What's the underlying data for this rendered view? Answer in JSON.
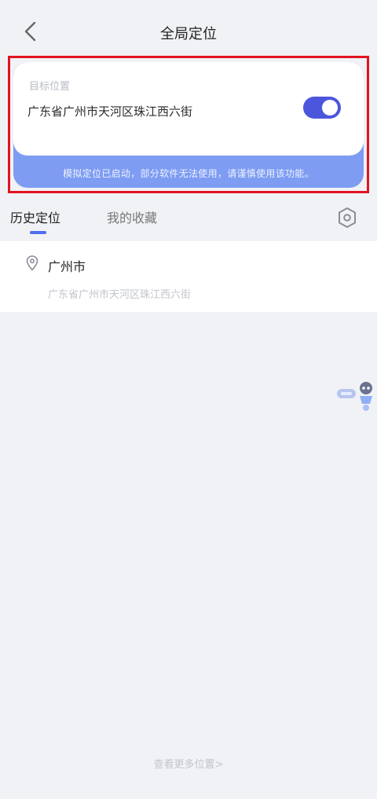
{
  "header": {
    "title": "全局定位"
  },
  "target": {
    "label": "目标位置",
    "address": "广东省广州市天河区珠江西六街",
    "enabled": true,
    "notice": "模拟定位已启动，部分软件无法使用，请谨慎使用该功能。"
  },
  "tabs": [
    {
      "label": "历史定位",
      "active": true
    },
    {
      "label": "我的收藏",
      "active": false
    }
  ],
  "history": {
    "items": [
      {
        "city": "广州市",
        "address": "广东省广州市天河区珠江西六街"
      }
    ],
    "more_label": "查看更多位置>"
  },
  "colors": {
    "accent": "#4b56dc",
    "banner": "#7d9cf2",
    "highlight": "#e0141f",
    "background": "#f1f2f6"
  },
  "icons": [
    "back-chevron-icon",
    "toggle-switch",
    "settings-hexagon-icon",
    "location-pin-icon",
    "assistant-robot-icon"
  ]
}
